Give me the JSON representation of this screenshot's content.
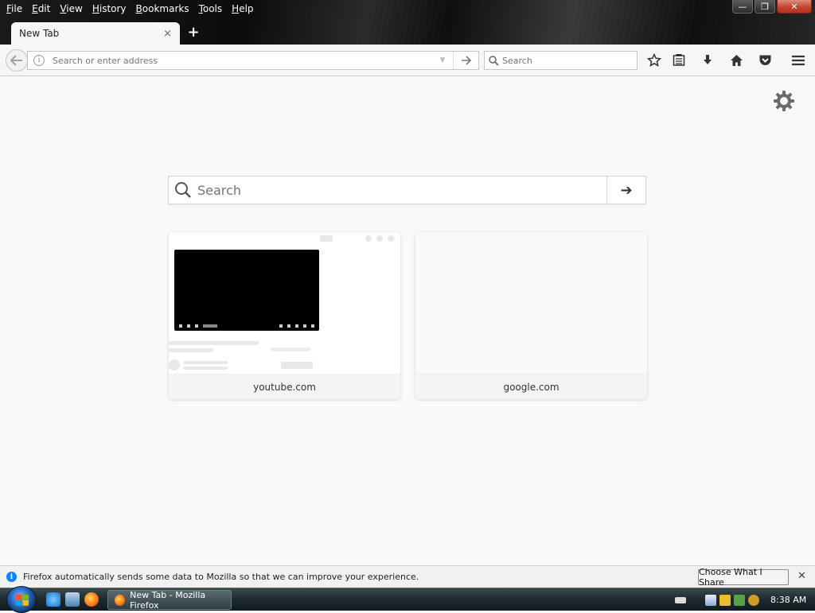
{
  "menubar": {
    "items": [
      "File",
      "Edit",
      "View",
      "History",
      "Bookmarks",
      "Tools",
      "Help"
    ]
  },
  "window_controls": {
    "minimize": "—",
    "restore": "❐",
    "close": "✕"
  },
  "tabs": [
    {
      "title": "New Tab",
      "close": "×"
    }
  ],
  "new_tab": "+",
  "navbar": {
    "url_placeholder": "Search or enter address",
    "search_placeholder": "Search",
    "icons": [
      "back-icon",
      "site-info-icon",
      "dropmarker-icon",
      "go-icon",
      "bookmark-star-icon",
      "bookmarks-list-icon",
      "download-icon",
      "home-icon",
      "pocket-icon",
      "hamburger-menu-icon"
    ]
  },
  "newtab": {
    "search_placeholder": "Search",
    "go": "➔",
    "tiles": [
      {
        "label": "youtube.com"
      },
      {
        "label": "google.com"
      }
    ]
  },
  "notification": {
    "message": "Firefox automatically sends some data to Mozilla so that we can improve your experience.",
    "button": "Choose What I Share",
    "close": "✕"
  },
  "taskbar": {
    "task_title": "New Tab - Mozilla Firefox",
    "clock": "8:38 AM"
  }
}
